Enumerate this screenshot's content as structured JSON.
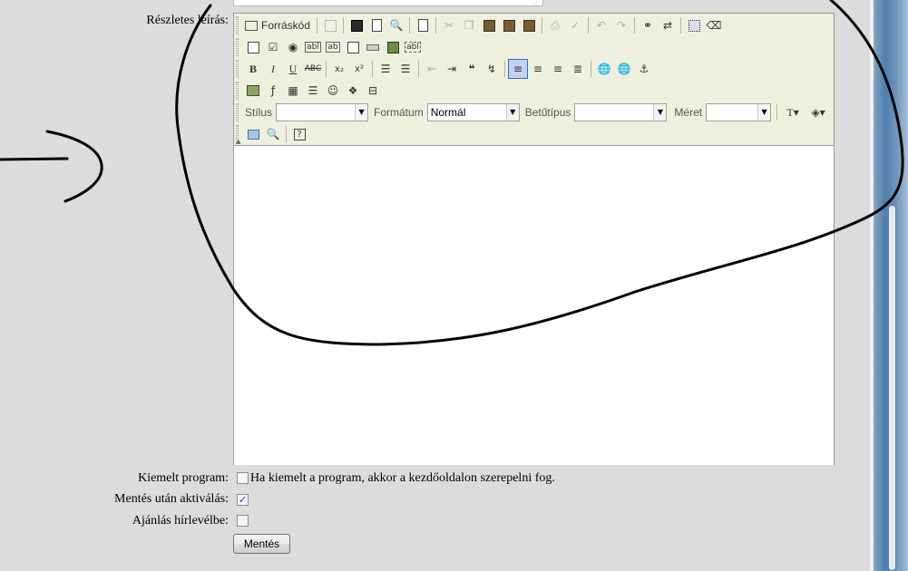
{
  "form": {
    "description_label": "Részletes leírás:",
    "featured_label": "Kiemelt program:",
    "featured_text": "Ha kiemelt a program, akkor a kezdőoldalon szerepelni fog.",
    "featured_checked": false,
    "activate_label": "Mentés után aktiválás:",
    "activate_checked": true,
    "newsletter_label": "Ajánlás hírlevélbe:",
    "newsletter_checked": false,
    "save_label": "Mentés"
  },
  "editor": {
    "source_label": "Forráskód",
    "style_label": "Stílus",
    "style_value": "",
    "format_label": "Formátum",
    "format_value": "Normál",
    "font_label": "Betűtípus",
    "font_value": "",
    "size_label": "Méret",
    "size_value": "",
    "body_text": ""
  },
  "icons": {
    "checkmark": "✓",
    "dropdown_arrow": "▼"
  }
}
